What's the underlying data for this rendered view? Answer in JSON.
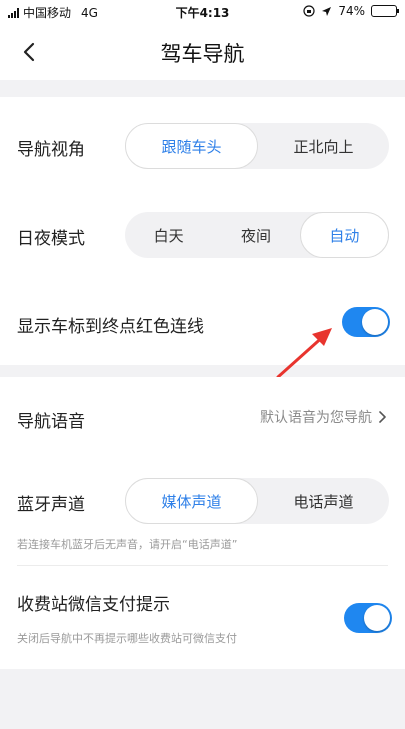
{
  "status_bar": {
    "carrier": "中国移动",
    "network": "4G",
    "time": "下午4:13",
    "battery": "74%",
    "battery_level": 0.74
  },
  "header": {
    "title": "驾车导航"
  },
  "settings": {
    "nav_view": {
      "label": "导航视角",
      "options": [
        "跟随车头",
        "正北向上"
      ],
      "selected": 0
    },
    "day_night": {
      "label": "日夜模式",
      "options": [
        "白天",
        "夜间",
        "自动"
      ],
      "selected": 2
    },
    "red_line": {
      "label": "显示车标到终点红色连线",
      "enabled": true
    },
    "nav_voice": {
      "label": "导航语音",
      "value": "默认语音为您导航"
    },
    "bt_channel": {
      "label": "蓝牙声道",
      "options": [
        "媒体声道",
        "电话声道"
      ],
      "selected": 0,
      "hint": "若连接车机蓝牙后无声音，请开启“电话声道”"
    },
    "toll_pay": {
      "label": "收费站微信支付提示",
      "enabled": true,
      "hint": "关闭后导航中不再提示哪些收费站可微信支付"
    }
  },
  "colors": {
    "accent": "#2f80e8",
    "toggle_on": "#1f87f0",
    "annotation": "#e8342e"
  }
}
